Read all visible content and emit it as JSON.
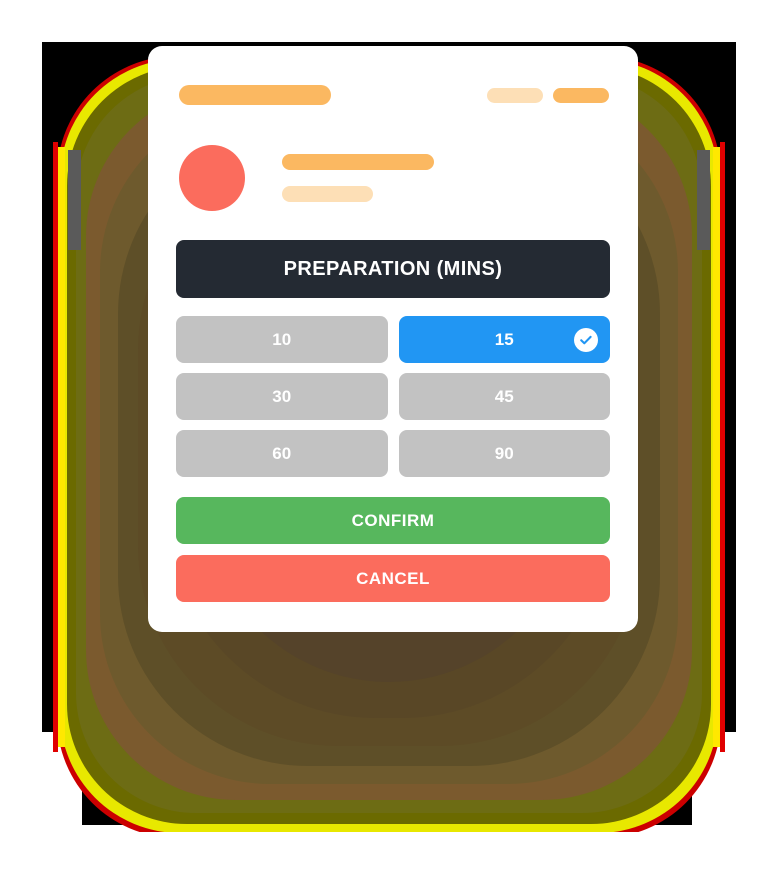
{
  "backdrop": {
    "plate_color": "#000000",
    "glow_colors": [
      "#cc0000",
      "#e8e800",
      "#6b6a00",
      "#7b5a2e",
      "#5d4b26"
    ]
  },
  "card": {
    "background": "#ffffff",
    "header": {
      "title_placeholder_color": "#fbb861",
      "tag_a_color": "#fddfb6",
      "tag_b_color": "#fbb861"
    },
    "profile": {
      "avatar_color": "#fb6c5d",
      "name_placeholder_color": "#fbb861",
      "subtitle_placeholder_color": "#fddfb6"
    },
    "title_bar": {
      "label": "PREPARATION (MINS)",
      "background": "#242a33",
      "text_color": "#ffffff"
    },
    "options": {
      "selected_value": "15",
      "selected_color": "#2196f3",
      "unselected_color": "#c2c2c2",
      "check_icon": "check-circle-icon",
      "items": [
        {
          "value": "10",
          "selected": false
        },
        {
          "value": "15",
          "selected": true
        },
        {
          "value": "30",
          "selected": false
        },
        {
          "value": "45",
          "selected": false
        },
        {
          "value": "60",
          "selected": false
        },
        {
          "value": "90",
          "selected": false
        }
      ]
    },
    "actions": {
      "confirm_label": "CONFIRM",
      "confirm_color": "#57b75d",
      "cancel_label": "CANCEL",
      "cancel_color": "#fb6c5d"
    }
  }
}
